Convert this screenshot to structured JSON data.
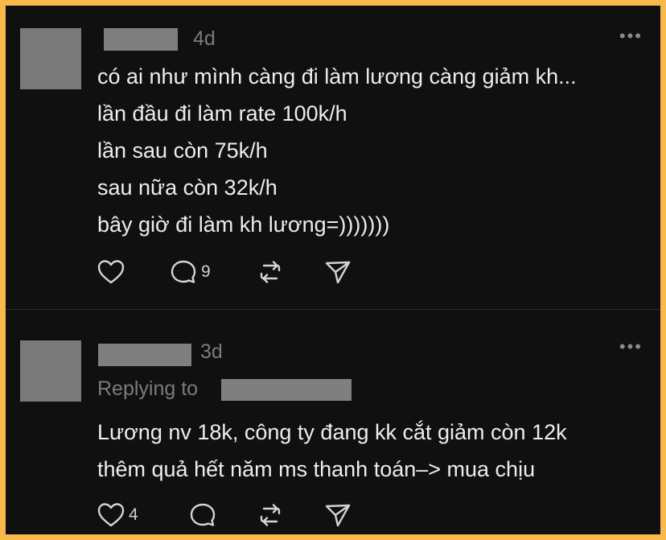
{
  "posts": [
    {
      "time": "4d",
      "more": "•••",
      "body": [
        "có ai như mình càng đi làm lương càng giảm kh...",
        "lần đầu đi làm rate 100k/h",
        "lần sau còn 75k/h",
        "sau nữa còn 32k/h",
        "bây giờ đi làm kh lương=)))))))"
      ],
      "reply_count": "9",
      "like_count": ""
    },
    {
      "time": "3d",
      "more": "•••",
      "replying_to": "Replying to",
      "body": [
        "Lương nv 18k, công ty đang kk cắt giảm còn 12k",
        "thêm quả hết năm ms thanh toán–> mua chịu"
      ],
      "like_count": "4",
      "reply_count": ""
    }
  ],
  "colors": {
    "background": "#101010",
    "border": "#f6b94a",
    "text": "#ededed",
    "muted": "#7b7b7b",
    "redaction": "#7f7f7f"
  },
  "icons": [
    "heart-icon",
    "comment-icon",
    "repost-icon",
    "share-icon",
    "more-icon"
  ]
}
